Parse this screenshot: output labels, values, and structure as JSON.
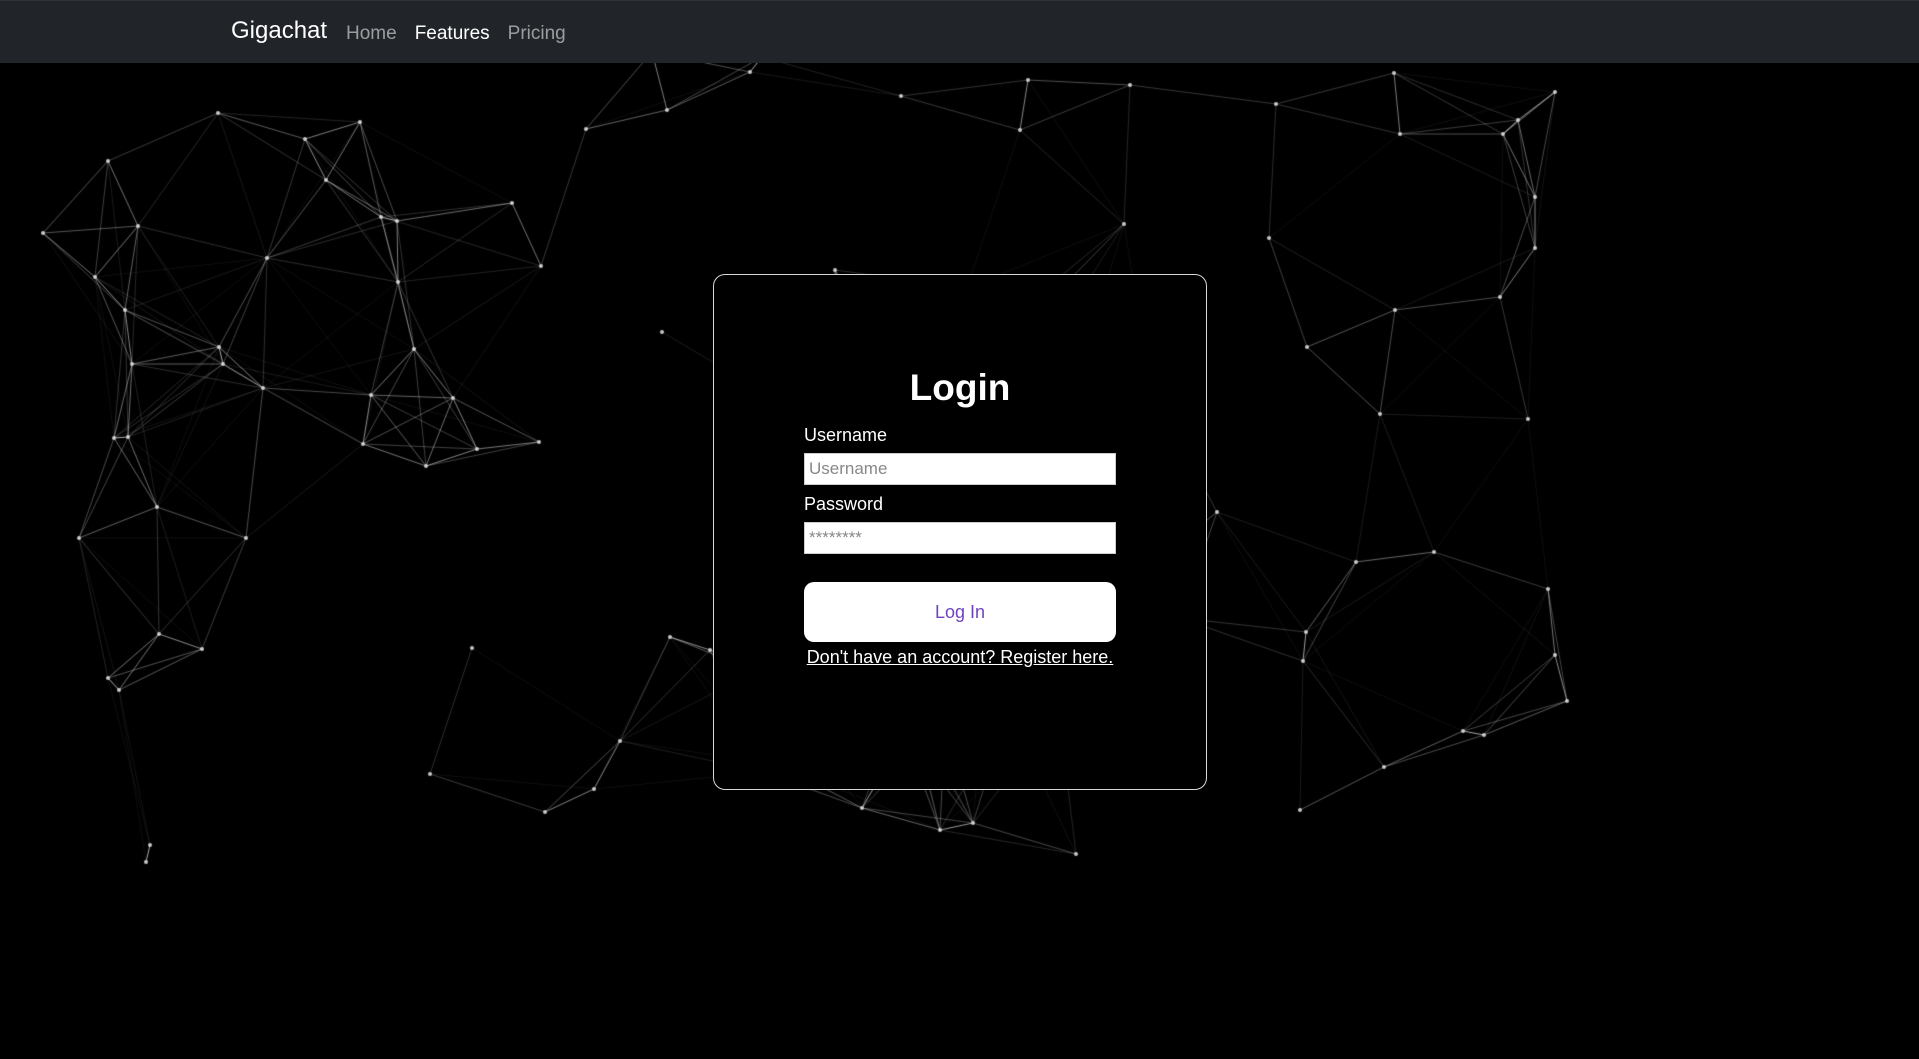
{
  "navbar": {
    "brand": "Gigachat",
    "links": [
      {
        "label": "Home"
      },
      {
        "label": "Features"
      },
      {
        "label": "Pricing"
      }
    ],
    "active_link": "Features",
    "background_color": "#212529"
  },
  "login_card": {
    "title": "Login",
    "username": {
      "label": "Username",
      "placeholder": "Username",
      "value": ""
    },
    "password": {
      "label": "Password",
      "placeholder": "********",
      "value": ""
    },
    "submit_label": "Log In",
    "register_text": "Don't have an account? Register here."
  },
  "background": {
    "style": "network-particles",
    "color": "#000000",
    "line_color": "#ffffff"
  },
  "colors": {
    "accent": "#6f42c1"
  }
}
